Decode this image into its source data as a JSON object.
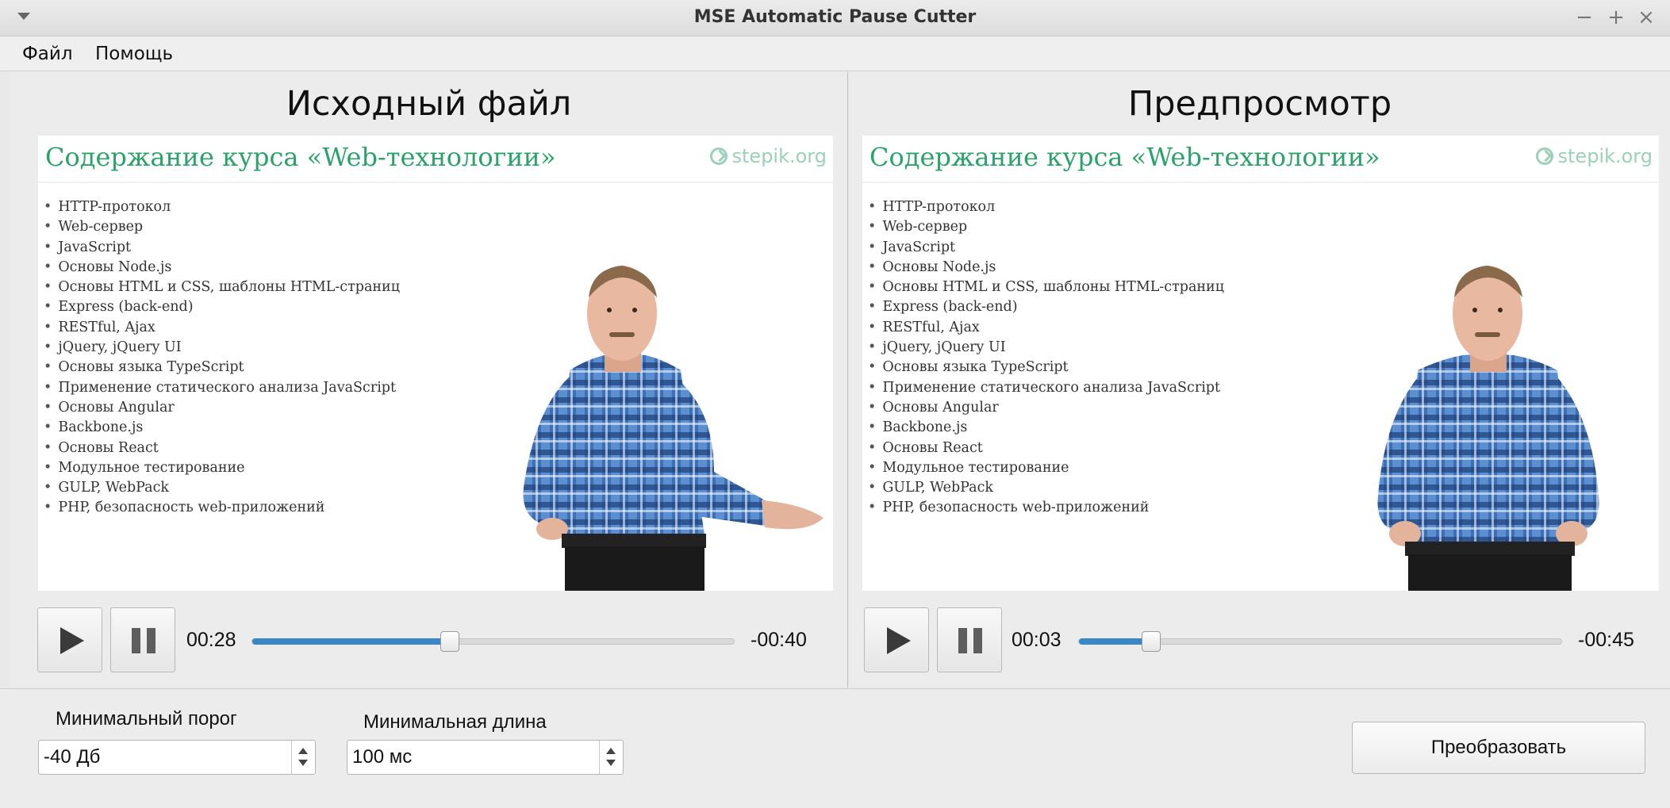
{
  "window": {
    "title": "MSE Automatic Pause Cutter",
    "minimize": "−",
    "maximize": "+",
    "close": "×"
  },
  "menu": {
    "file": "Файл",
    "help": "Помощь"
  },
  "slide": {
    "title": "Содержание курса «Web-технологии»",
    "brand": "stepik.org",
    "topics": [
      "HTTP-протокол",
      "Web-сервер",
      "JavaScript",
      "Основы Node.js",
      "Основы HTML и CSS, шаблоны HTML-страниц",
      "Express (back-end)",
      "RESTful, Ajax",
      "jQuery, jQuery UI",
      "Основы языка TypeScript",
      "Применение статического анализа JavaScript",
      "Основы Angular",
      "Backbone.js",
      "Основы React",
      "Модульное тестирование",
      "GULP, WebPack",
      "PHP, безопасность web-приложений"
    ]
  },
  "source": {
    "title": "Исходный файл",
    "time_current": "00:28",
    "time_remaining": "-00:40",
    "progress": 0.41
  },
  "preview": {
    "title": "Предпросмотр",
    "time_current": "00:03",
    "time_remaining": "-00:45",
    "progress": 0.15
  },
  "settings": {
    "threshold_label": "Минимальный порог",
    "threshold_value": "-40 Дб",
    "length_label": "Минимальная длина",
    "length_value": "100 мс",
    "convert_label": "Преобразовать"
  },
  "colors": {
    "accent": "#3a87c8",
    "slide_title": "#2aa36b",
    "shirt_blue": "#3b6fb6"
  },
  "icons": [
    "window-menu-icon",
    "minimize-icon",
    "maximize-icon",
    "close-icon",
    "play-icon",
    "pause-icon",
    "spin-up-icon",
    "spin-down-icon",
    "stepik-logo-icon"
  ]
}
